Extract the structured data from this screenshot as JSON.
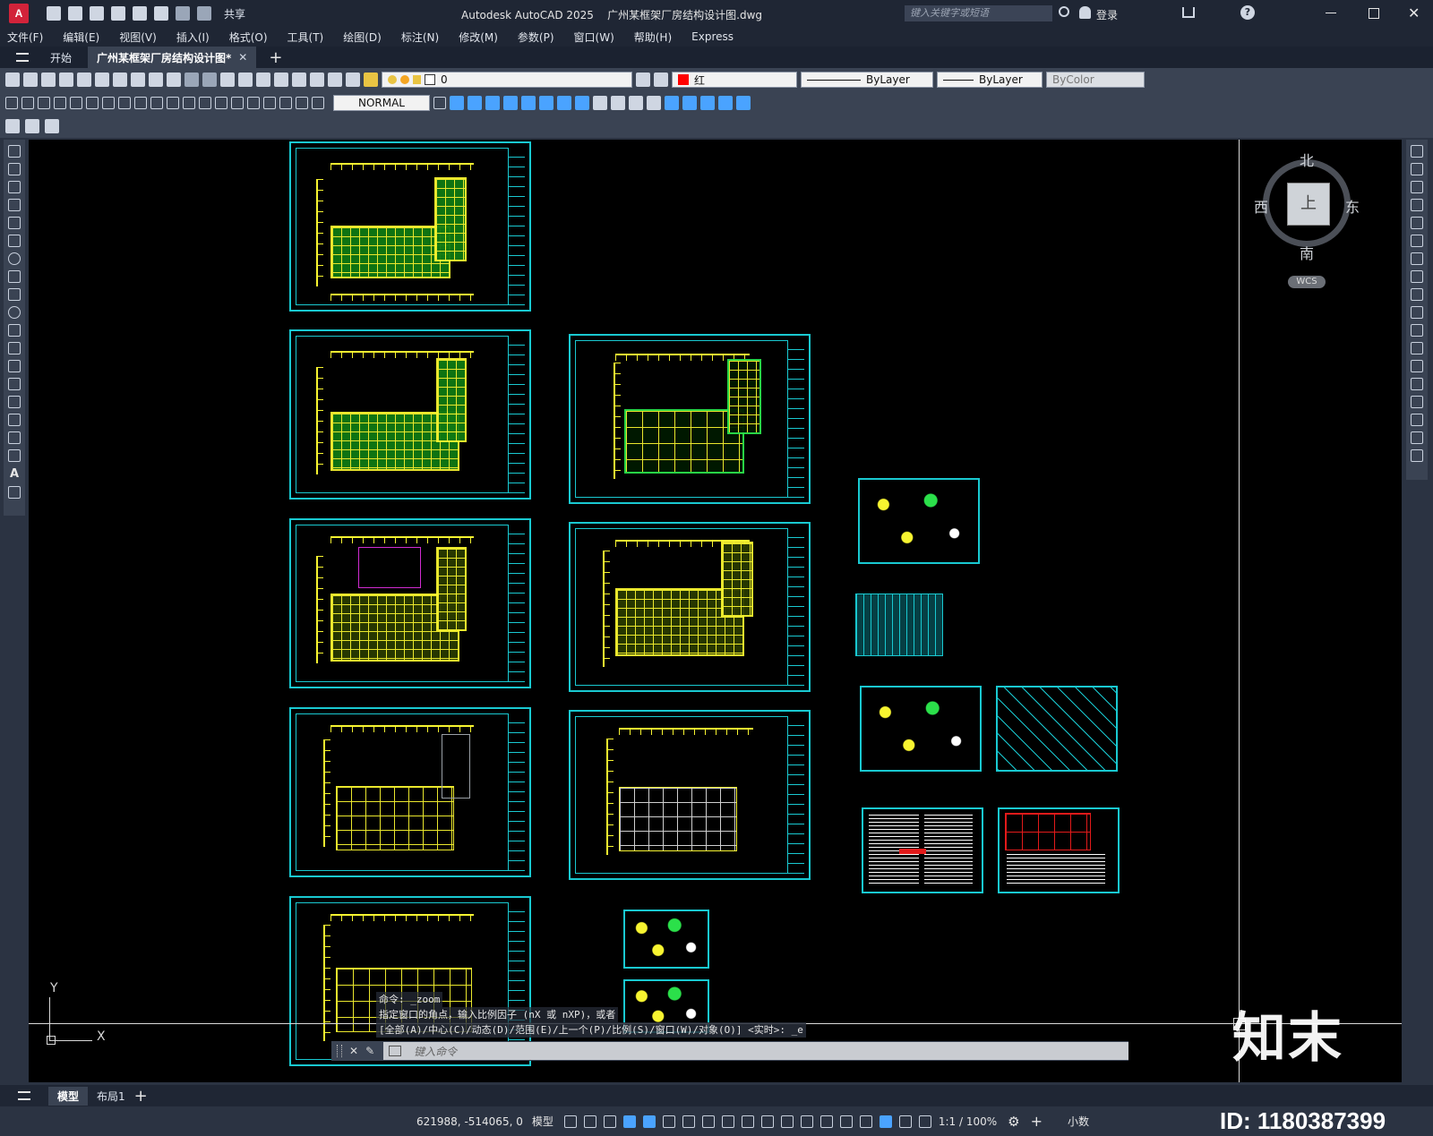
{
  "app": {
    "title": "Autodesk AutoCAD 2025    广州某框架厂房结构设计图.dwg",
    "search_placeholder": "键入关键字或短语",
    "login_label": "登录",
    "share_label": "共享"
  },
  "menu": [
    "文件(F)",
    "编辑(E)",
    "视图(V)",
    "插入(I)",
    "格式(O)",
    "工具(T)",
    "绘图(D)",
    "标注(N)",
    "修改(M)",
    "参数(P)",
    "窗口(W)",
    "帮助(H)",
    "Express"
  ],
  "tabs": {
    "start": "开始",
    "active": "广州某框架厂房结构设计图*"
  },
  "properties": {
    "layer": "0",
    "color_label": "红",
    "color_hex": "#ff0000",
    "linetype": "ByLayer",
    "lineweight": "ByLayer",
    "plotstyle": "ByColor",
    "dimstyle": "NORMAL"
  },
  "viewcube": {
    "north": "北",
    "south": "南",
    "east": "东",
    "west": "西",
    "top": "上",
    "wcs": "WCS"
  },
  "ucs": {
    "x": "X",
    "y": "Y"
  },
  "command": {
    "line1": "命令: _zoom",
    "line2": "指定窗口的角点，输入比例因子 (nX 或 nXP)，或者",
    "line3": "[全部(A)/中心(C)/动态(D)/范围(E)/上一个(P)/比例(S)/窗口(W)/对象(O)] <实时>: _e",
    "placeholder": "键入命令"
  },
  "layouts": {
    "model": "模型",
    "layout1": "布局1"
  },
  "status": {
    "coords": "621988, -514065, 0",
    "mode": "模型",
    "scale": "1:1 / 100%",
    "units": "小数"
  },
  "watermark": {
    "brand": "知末",
    "id": "ID: 1180387399"
  },
  "colors": {
    "sheet_border": "#19c9d1",
    "axis": "#f7f430",
    "fill": "#0f7a14",
    "canvas": "#000000"
  }
}
